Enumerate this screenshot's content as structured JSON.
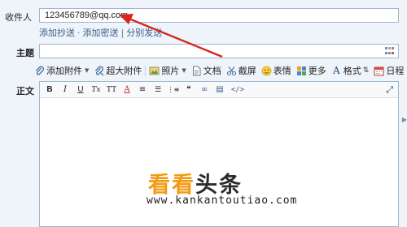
{
  "form": {
    "to_label": "收件人",
    "to_value": "123456789@qq.com",
    "add_cc": "添加抄送",
    "add_bcc": "添加密送",
    "separate_send": "分别发送",
    "link_sep": "·",
    "link_sep2": "|",
    "subject_label": "主题",
    "subject_value": "",
    "body_label": "正文"
  },
  "toolbar": {
    "attachment": "添加附件",
    "large_attachment": "超大附件",
    "photo": "照片",
    "document": "文档",
    "screenshot": "截屏",
    "emoji": "表情",
    "more": "更多",
    "format": "格式",
    "calendar": "日程"
  },
  "format_bar": {
    "bold": "B",
    "italic": "I",
    "underline": "U",
    "clear_format": "Tx",
    "font_size": "TT",
    "font_color": "A",
    "align": "≡",
    "bullets": "☰",
    "numbering": "⋮≡",
    "quote": "❝",
    "link": "∞",
    "insert": "▤",
    "code": "</>"
  },
  "watermark": {
    "brand_a": "看看",
    "brand_b": "头条",
    "url": "www.kankantoutiao.com"
  },
  "colors": {
    "accent_orange": "#f39a12",
    "arrow_red": "#d9261c",
    "link_blue": "#3a5c8a",
    "border_blue": "#9fb7d1"
  }
}
